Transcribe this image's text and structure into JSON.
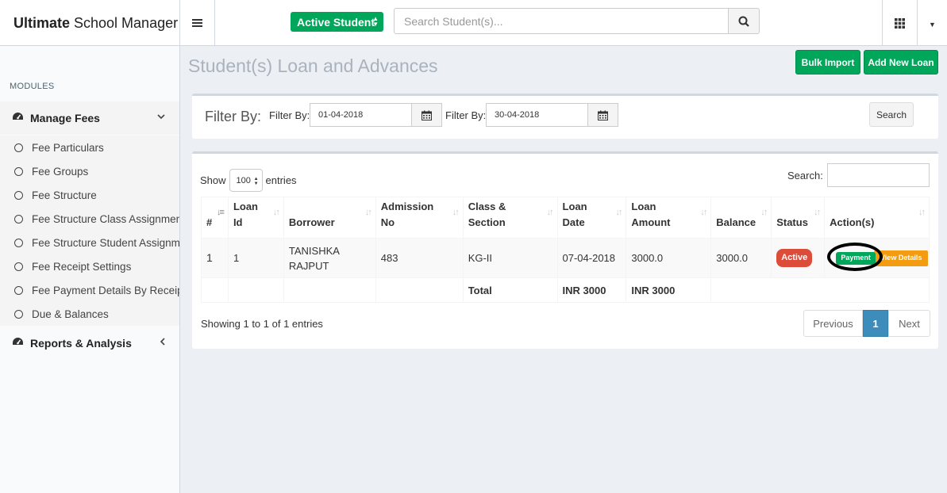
{
  "header": {
    "brand_bold": "Ultimate",
    "brand_rest": "School Manager",
    "active_student_label": "Active Student",
    "search_placeholder": "Search Student(s)..."
  },
  "sidebar": {
    "section_label": "MODULES",
    "manage_fees": "Manage Fees",
    "items": [
      {
        "label": "Fee Particulars"
      },
      {
        "label": "Fee Groups"
      },
      {
        "label": "Fee Structure"
      },
      {
        "label": "Fee Structure Class Assignment"
      },
      {
        "label": "Fee Structure Student Assignment"
      },
      {
        "label": "Fee Receipt Settings"
      },
      {
        "label": "Fee Payment Details By Receipt No"
      },
      {
        "label": "Due & Balances"
      }
    ],
    "reports": "Reports & Analysis"
  },
  "page": {
    "title": "Student(s) Loan and Advances",
    "bulk_import": "Bulk Import",
    "add_new_loan": "Add New Loan"
  },
  "filter": {
    "heading": "Filter By:",
    "from_label": "Filter By:",
    "from_value": "01-04-2018",
    "to_label": "Filter By:",
    "to_value": "30-04-2018",
    "search_label": "Search"
  },
  "table": {
    "show_label": "Show",
    "entries_label": "entries",
    "page_length": "100",
    "search_label": "Search:",
    "columns": [
      "#",
      "Loan Id",
      "Borrower",
      "Admission No",
      "Class & Section",
      "Loan Date",
      "Loan Amount",
      "Balance",
      "Status",
      "Action(s)"
    ],
    "rows": [
      {
        "num": "1",
        "loan_id": "1",
        "borrower": "TANISHKA RAJPUT",
        "admission_no": "483",
        "class_section": "KG-II",
        "loan_date": "07-04-2018",
        "loan_amount": "3000.0",
        "balance": "3000.0",
        "status": "Active",
        "action_payment": "Payment",
        "action_view": "View Details"
      }
    ],
    "total_label": "Total",
    "total_loan_date_col": "INR 3000",
    "total_amount_col": "INR 3000",
    "info": "Showing 1 to 1 of 1 entries",
    "pager": {
      "previous": "Previous",
      "current": "1",
      "next": "Next"
    }
  },
  "colors": {
    "green": "#00a65a",
    "red": "#dd4b39",
    "orange": "#f39c12",
    "blue": "#3c8dbc"
  }
}
